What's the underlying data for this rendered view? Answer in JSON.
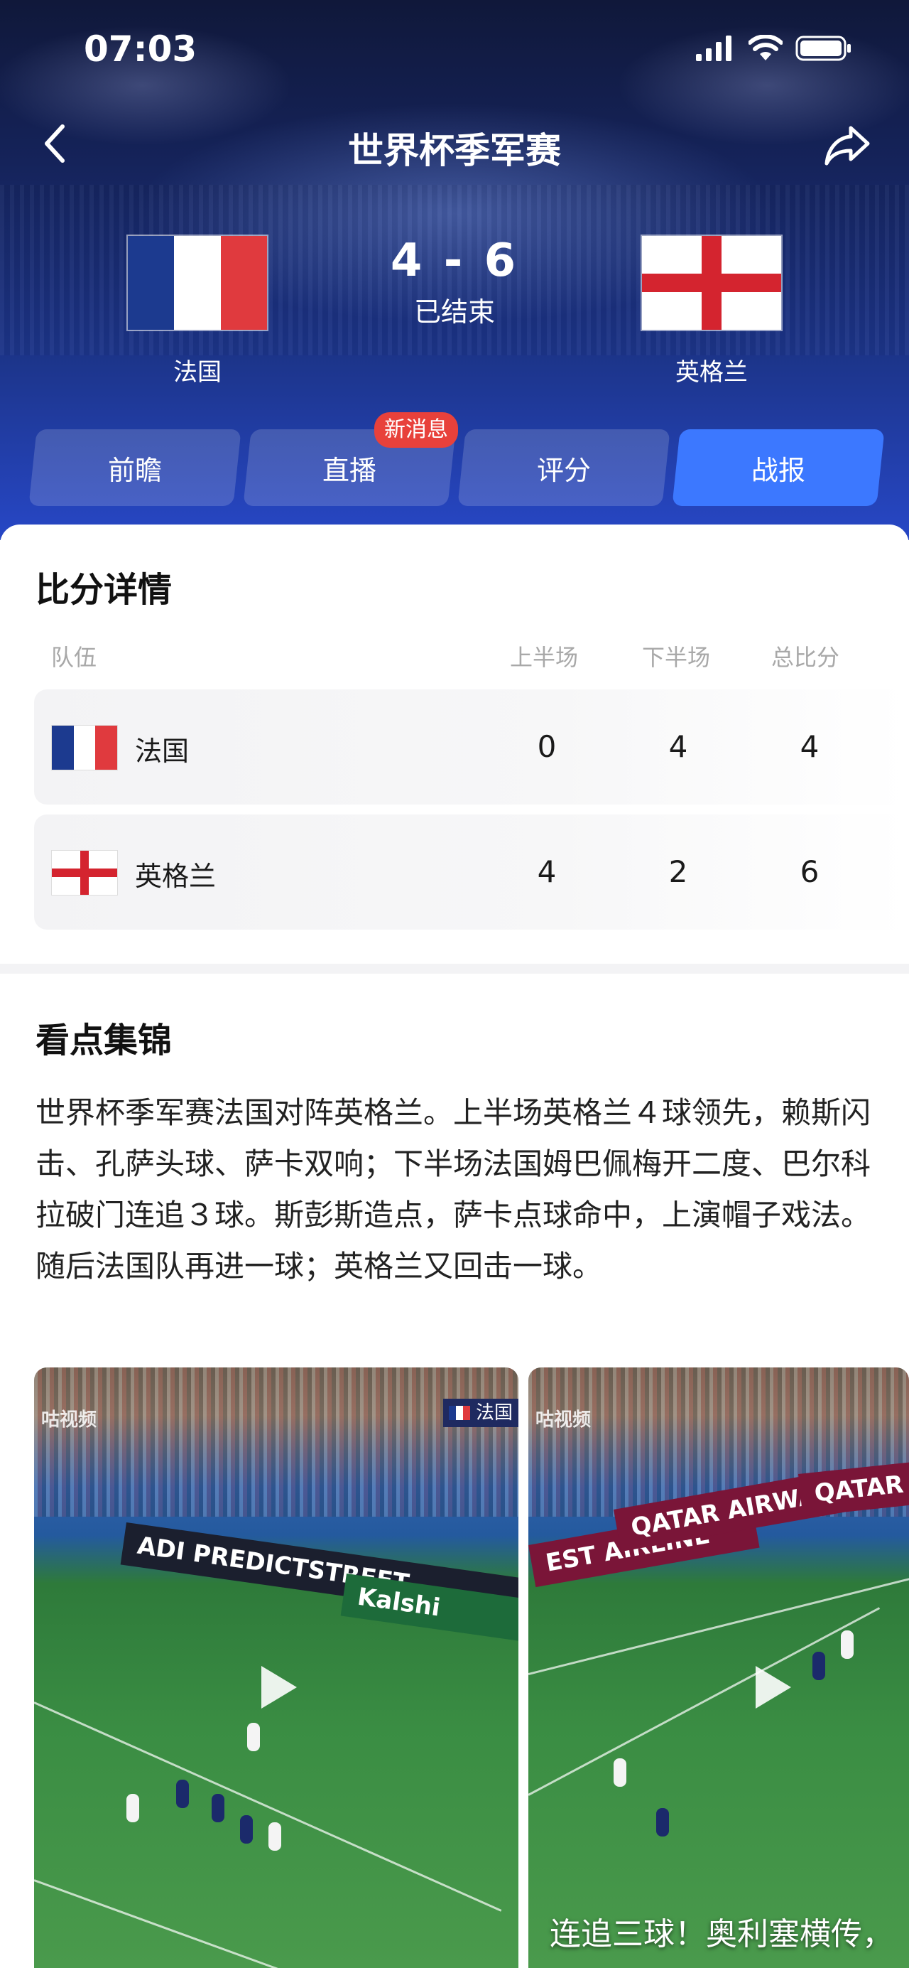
{
  "status_bar": {
    "time": "07:03"
  },
  "header": {
    "title": "世界杯季军赛"
  },
  "match": {
    "home": {
      "name": "法国",
      "flag": "france"
    },
    "away": {
      "name": "英格兰",
      "flag": "england"
    },
    "score": "4 - 6",
    "status": "已结束"
  },
  "tabs": [
    {
      "label": "前瞻",
      "active": false
    },
    {
      "label": "直播",
      "active": false
    },
    {
      "label": "评分",
      "active": false
    },
    {
      "label": "战报",
      "active": true
    }
  ],
  "badge": "新消息",
  "score_details": {
    "title": "比分详情",
    "columns": [
      "队伍",
      "上半场",
      "下半场",
      "总比分"
    ],
    "rows": [
      {
        "team": "法国",
        "first_half": "0",
        "second_half": "4",
        "total": "4"
      },
      {
        "team": "英格兰",
        "first_half": "4",
        "second_half": "2",
        "total": "6"
      }
    ]
  },
  "highlights": {
    "title": "看点集锦",
    "summary": "世界杯季军赛法国对阵英格兰。上半场英格兰４球领先，赖斯闪击、孔萨头球、萨卡双响；下半场法国姆巴佩梅开二度、巴尔科拉破门连追３球。斯彭斯造点，萨卡点球命中，上演帽子戏法。随后法国队再进一球；英格兰又回击一球。",
    "videos": [
      {
        "watermark": "咕视频",
        "tag": "法国",
        "boards": [
          "ADI PREDICTSTREET",
          "Kalshi"
        ],
        "caption": ""
      },
      {
        "watermark": "咕视频",
        "tag": "",
        "boards": [
          "EST AIRLINE",
          "QATAR AIRWAYS",
          "QATAR AI"
        ],
        "caption": "连追三球！奥利塞横传，"
      }
    ]
  },
  "colors": {
    "accent": "#3c78ff",
    "badge": "#e8413b",
    "header_top": "#10183a",
    "header_bottom": "#2747c6"
  }
}
